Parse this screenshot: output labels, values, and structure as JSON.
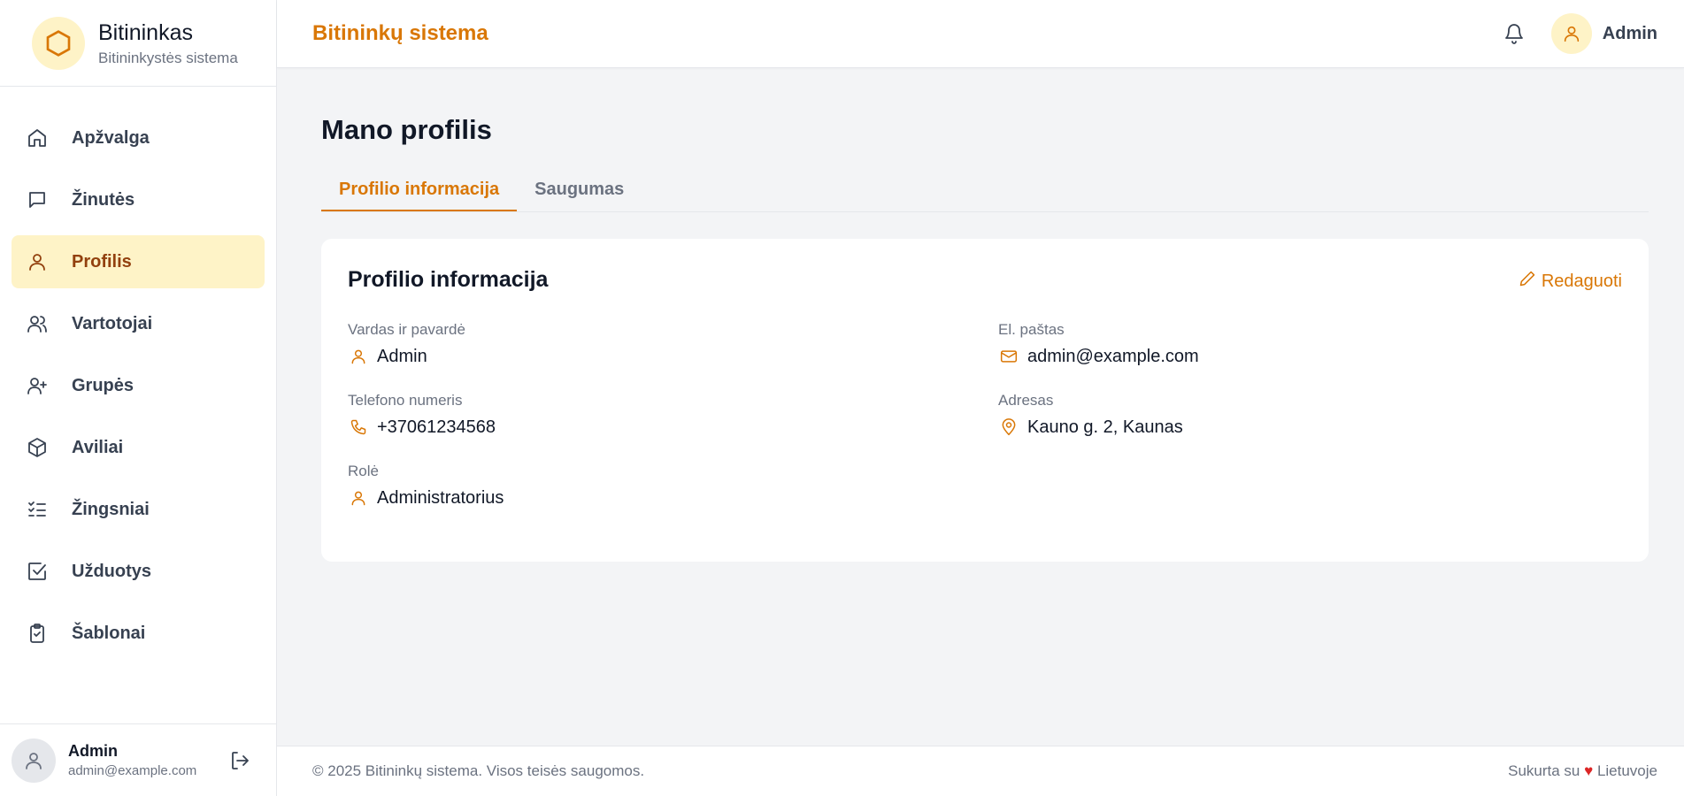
{
  "colors": {
    "accent": "#d97706",
    "accent_bg": "#fef3c7",
    "active_text": "#92400e",
    "heart": "#dc2626"
  },
  "brand": {
    "title": "Bitininkas",
    "subtitle": "Bitininkystės sistema",
    "icon": "hexagon-icon"
  },
  "sidebar": {
    "items": [
      {
        "label": "Apžvalga",
        "icon": "home-icon"
      },
      {
        "label": "Žinutės",
        "icon": "message-icon"
      },
      {
        "label": "Profilis",
        "icon": "user-icon",
        "active": true
      },
      {
        "label": "Vartotojai",
        "icon": "users-icon"
      },
      {
        "label": "Grupės",
        "icon": "user-plus-icon"
      },
      {
        "label": "Aviliai",
        "icon": "box-icon"
      },
      {
        "label": "Žingsniai",
        "icon": "list-checks-icon"
      },
      {
        "label": "Užduotys",
        "icon": "check-square-icon"
      },
      {
        "label": "Šablonai",
        "icon": "clipboard-check-icon"
      }
    ]
  },
  "user": {
    "name": "Admin",
    "email": "admin@example.com"
  },
  "header": {
    "title": "Bitininkų sistema",
    "user_name": "Admin"
  },
  "main": {
    "page_title": "Mano profilis",
    "tabs": [
      {
        "label": "Profilio informacija",
        "active": true
      },
      {
        "label": "Saugumas"
      }
    ],
    "card": {
      "title": "Profilio informacija",
      "edit_label": "Redaguoti",
      "fields": {
        "name": {
          "label": "Vardas ir pavardė",
          "value": "Admin",
          "icon": "user-icon"
        },
        "email": {
          "label": "El. paštas",
          "value": "admin@example.com",
          "icon": "mail-icon"
        },
        "phone": {
          "label": "Telefono numeris",
          "value": "+37061234568",
          "icon": "phone-icon"
        },
        "address": {
          "label": "Adresas",
          "value": "Kauno g. 2, Kaunas",
          "icon": "map-pin-icon"
        },
        "role": {
          "label": "Rolė",
          "value": "Administratorius",
          "icon": "user-icon"
        }
      }
    }
  },
  "footer": {
    "copyright": "© 2025 Bitininkų sistema. Visos teisės saugomos.",
    "made_prefix": "Sukurta su",
    "heart": "♥",
    "made_suffix": "Lietuvoje"
  }
}
